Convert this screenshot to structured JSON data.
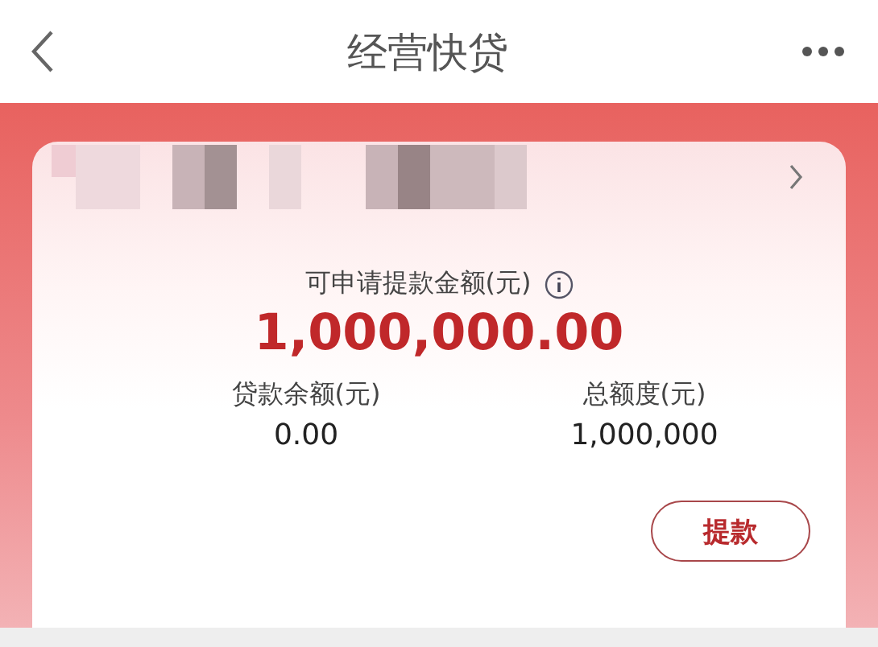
{
  "header": {
    "title": "经营快贷"
  },
  "card": {
    "available_label": "可申请提款金额(元)",
    "available_amount": "1,000,000.00",
    "stats": [
      {
        "label": "贷款余额(元)",
        "value": "0.00"
      },
      {
        "label": "总额度(元)",
        "value": "1,000,000"
      }
    ],
    "button": "提款"
  }
}
